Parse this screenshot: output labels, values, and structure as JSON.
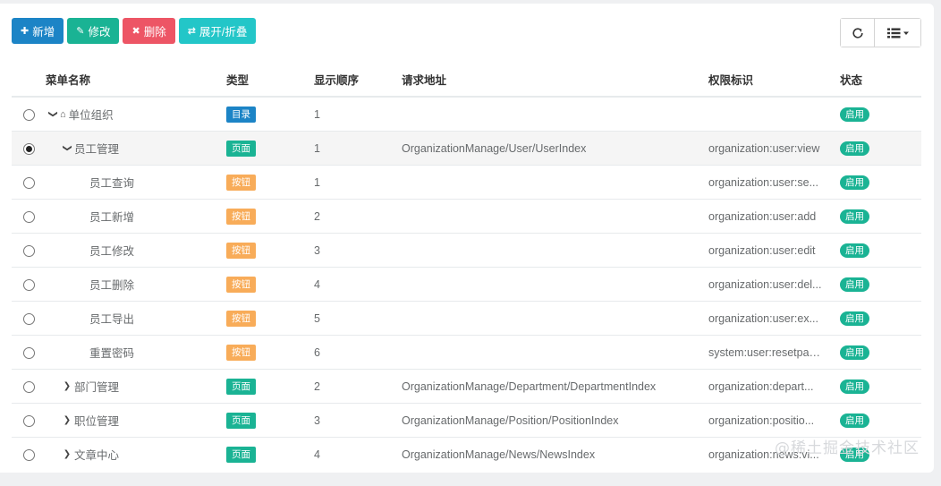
{
  "toolbar": {
    "add_label": "新增",
    "edit_label": "修改",
    "delete_label": "删除",
    "toggle_label": "展开/折叠"
  },
  "columns": {
    "name": "菜单名称",
    "type": "类型",
    "order": "显示顺序",
    "url": "请求地址",
    "perm": "权限标识",
    "status": "状态"
  },
  "rows": [
    {
      "name": "单位组织",
      "type": "目录",
      "order": "1",
      "url": "",
      "perm": "",
      "status": "启用"
    },
    {
      "name": "员工管理",
      "type": "页面",
      "order": "1",
      "url": "OrganizationManage/User/UserIndex",
      "perm": "organization:user:view",
      "status": "启用"
    },
    {
      "name": "员工查询",
      "type": "按钮",
      "order": "1",
      "url": "",
      "perm": "organization:user:se...",
      "status": "启用"
    },
    {
      "name": "员工新增",
      "type": "按钮",
      "order": "2",
      "url": "",
      "perm": "organization:user:add",
      "status": "启用"
    },
    {
      "name": "员工修改",
      "type": "按钮",
      "order": "3",
      "url": "",
      "perm": "organization:user:edit",
      "status": "启用"
    },
    {
      "name": "员工删除",
      "type": "按钮",
      "order": "4",
      "url": "",
      "perm": "organization:user:del...",
      "status": "启用"
    },
    {
      "name": "员工导出",
      "type": "按钮",
      "order": "5",
      "url": "",
      "perm": "organization:user:ex...",
      "status": "启用"
    },
    {
      "name": "重置密码",
      "type": "按钮",
      "order": "6",
      "url": "",
      "perm": "system:user:resetpas...",
      "status": "启用"
    },
    {
      "name": "部门管理",
      "type": "页面",
      "order": "2",
      "url": "OrganizationManage/Department/DepartmentIndex",
      "perm": "organization:depart...",
      "status": "启用"
    },
    {
      "name": "职位管理",
      "type": "页面",
      "order": "3",
      "url": "OrganizationManage/Position/PositionIndex",
      "perm": "organization:positio...",
      "status": "启用"
    },
    {
      "name": "文章中心",
      "type": "页面",
      "order": "4",
      "url": "OrganizationManage/News/NewsIndex",
      "perm": "organization:news:vi...",
      "status": "启用"
    }
  ],
  "watermark": "@稀土掘金技术社区",
  "colors": {
    "primary": "#1c84c6",
    "success": "#1ab394",
    "danger": "#ed5565",
    "info": "#23c6c8",
    "warning": "#f8ac59"
  }
}
